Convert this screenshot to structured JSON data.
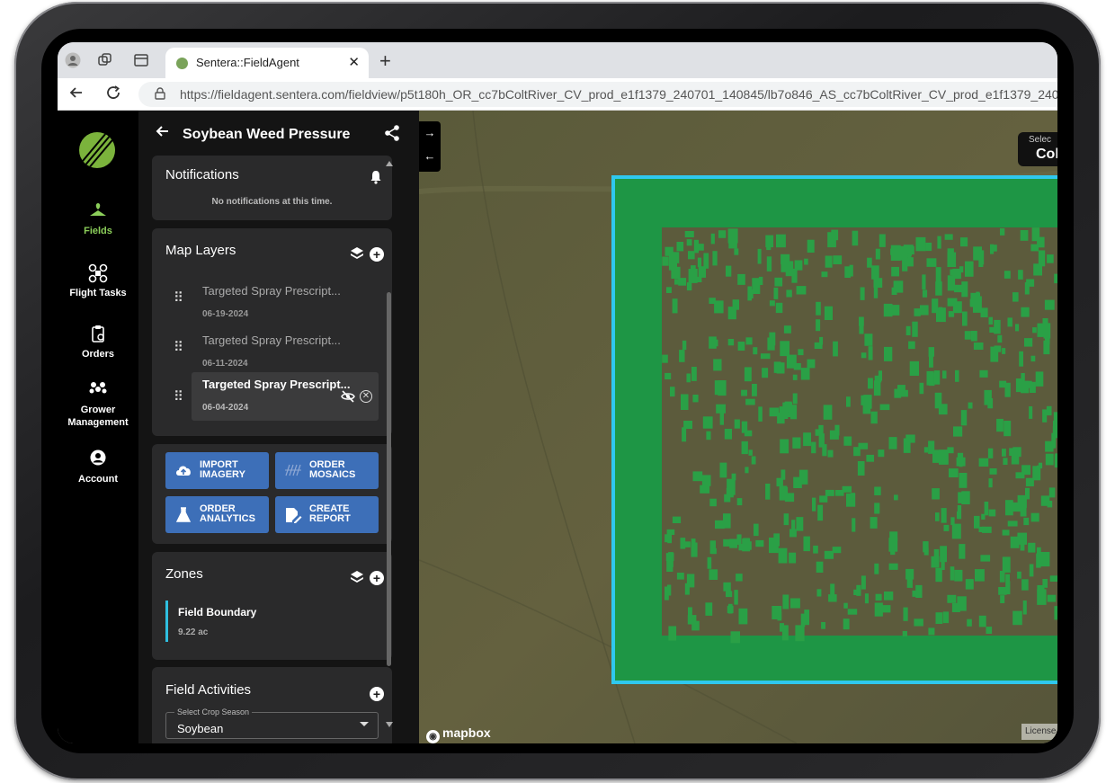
{
  "browser": {
    "tab_title": "Sentera::FieldAgent",
    "url": "https://fieldagent.sentera.com/fieldview/p5t180h_OR_cc7bColtRiver_CV_prod_e1f1379_240701_140845/lb7o846_AS_cc7bColtRiver_CV_prod_e1f1379_240701_143249?..."
  },
  "nav": {
    "items": [
      {
        "label": "Fields",
        "icon": "field-icon",
        "active": true
      },
      {
        "label": "Flight Tasks",
        "icon": "drone-icon"
      },
      {
        "label": "Orders",
        "icon": "clipboard-icon"
      },
      {
        "label": "Grower Management",
        "icon": "group-icon"
      },
      {
        "label": "Account",
        "icon": "account-icon"
      }
    ]
  },
  "panel": {
    "title": "Soybean Weed Pressure",
    "notifications": {
      "title": "Notifications",
      "empty_text": "No notifications at this time."
    },
    "map_layers": {
      "title": "Map Layers",
      "items": [
        {
          "name": "Targeted Spray Prescript...",
          "date": "06-19-2024"
        },
        {
          "name": "Targeted Spray Prescript...",
          "date": "06-11-2024"
        },
        {
          "name": "Targeted Spray Prescript...",
          "date": "06-04-2024",
          "selected": true
        }
      ]
    },
    "actions": [
      {
        "label": "IMPORT IMAGERY",
        "icon": "cloud-upload-icon"
      },
      {
        "label": "ORDER MOSAICS",
        "icon": "mosaic-icon"
      },
      {
        "label": "ORDER ANALYTICS",
        "icon": "flask-icon"
      },
      {
        "label": "CREATE REPORT",
        "icon": "report-edit-icon"
      }
    ],
    "zones": {
      "title": "Zones",
      "items": [
        {
          "name": "Field Boundary",
          "area": "9.22 ac"
        }
      ]
    },
    "field_activities": {
      "title": "Field Activities",
      "crop_season_label": "Select Crop Season",
      "crop_season_value": "Soybean"
    }
  },
  "map": {
    "season_label": "Selec",
    "season_value": "Col",
    "attribution": "mapbox",
    "license": "License"
  },
  "colors": {
    "accent_green": "#8ccf5a",
    "button_blue": "#3d6fb8",
    "zone_cyan": "#2fbfe0",
    "field_fill": "#1e9645",
    "boundary": "#2fc8ee",
    "weed_patch": "#2aa046"
  }
}
